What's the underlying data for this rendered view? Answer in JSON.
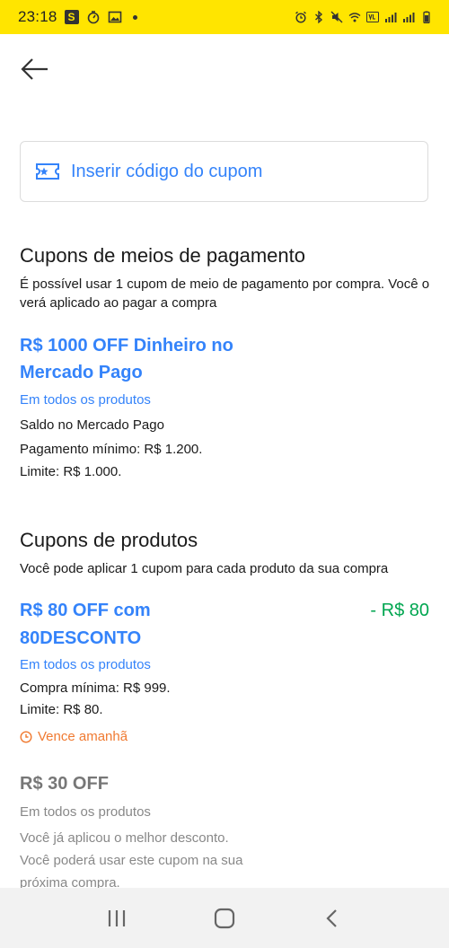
{
  "status_bar": {
    "time": "23:18",
    "icons": [
      "s-app-icon",
      "timer-icon",
      "image-icon",
      "dot-icon",
      "alarm-icon",
      "bluetooth-icon",
      "mute-icon",
      "wifi-icon",
      "volte-icon",
      "signal-icon",
      "signal-icon",
      "battery-icon"
    ]
  },
  "header": {
    "back_icon": "arrow-left-icon"
  },
  "coupon_input": {
    "label": "Inserir código do cupom",
    "icon": "ticket-star-icon"
  },
  "payment_section": {
    "title": "Cupons de meios de pagamento",
    "description": "É possível usar 1 cupom de meio de pagamento por compra. Você o verá aplicado ao pagar a compra",
    "coupons": [
      {
        "title_line1": "R$ 1000 OFF Dinheiro no",
        "title_line2": "Mercado Pago",
        "scope": "Em todos os produtos",
        "lines": [
          "Saldo no Mercado Pago",
          "Pagamento mínimo: R$ 1.200.",
          "Limite: R$ 1.000."
        ]
      }
    ]
  },
  "products_section": {
    "title": "Cupons de produtos",
    "description": "Você pode aplicar 1 cupom para cada produto da sua compra",
    "coupons": [
      {
        "title_line1": "R$ 80 OFF com",
        "title_line2": "80DESCONTO",
        "discount": "- R$ 80",
        "scope": "Em todos os produtos",
        "lines": [
          "Compra mínima: R$ 999.",
          "Limite: R$ 80."
        ],
        "expiry": "Vence amanhã"
      },
      {
        "title": "R$ 30 OFF",
        "scope": "Em todos os produtos",
        "lines": [
          "Você já aplicou o melhor desconto.",
          "Você poderá usar este cupom na sua",
          "próxima compra."
        ]
      }
    ]
  },
  "nav_bar": {
    "icons": [
      "recent-apps-icon",
      "home-icon",
      "back-icon"
    ]
  },
  "colors": {
    "accent": "#3483fa",
    "status_bar": "#ffe500",
    "discount": "#00a650",
    "expiry": "#f07a31"
  }
}
